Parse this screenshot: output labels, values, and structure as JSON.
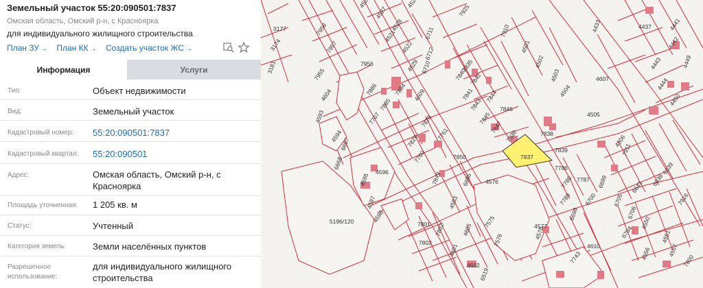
{
  "panel": {
    "title": "Земельный участок 55:20:090501:7837",
    "address_sub": "Омская область, Омский р-н, с Красноярка",
    "purpose": "для индивидуального жилищного строительства",
    "links": [
      {
        "label": "План ЗУ",
        "arrow": "→"
      },
      {
        "label": "План КК",
        "arrow": "→"
      },
      {
        "label": "Создать участок ЖС",
        "arrow": "→"
      }
    ],
    "tools": [
      "map-search-icon",
      "star-icon"
    ],
    "tabs": [
      {
        "label": "Информация",
        "active": true
      },
      {
        "label": "Услуги",
        "active": false
      }
    ],
    "fields": [
      {
        "label": "Тип:",
        "value": "Объект недвижимости",
        "link": false
      },
      {
        "label": "Вид:",
        "value": "Земельный участок",
        "link": false
      },
      {
        "label": "Кадастровый номер:",
        "value": "55:20:090501:7837",
        "link": true
      },
      {
        "label": "Кадастровый квартал:",
        "value": "55:20:090501",
        "link": true
      },
      {
        "label": "Адрес:",
        "value": "Омская область, Омский р-н, с Красноярка",
        "link": false
      },
      {
        "label": "Площадь уточненная:",
        "value": "1 205 кв. м",
        "link": false
      },
      {
        "label": "Статус:",
        "value": "Учтенный",
        "link": false
      },
      {
        "label": "Категория земель:",
        "value": "Земли населённых пунктов",
        "link": false
      },
      {
        "label": "Разрешенное использование:",
        "value": "для индивидуального жилищного строительства",
        "link": false
      }
    ]
  },
  "map": {
    "colors": {
      "boundary": "#d0303d",
      "building": "#e07a84",
      "highlight": "#fff170",
      "background": "#f3f1ee"
    },
    "highlight_label": "7837",
    "parcels": [
      "4526",
      "4527",
      "4528",
      "4524",
      "7925",
      "4521",
      "4522",
      "6711",
      "6712",
      "3177",
      "7958",
      "7957",
      "4529",
      "6710",
      "7956",
      "7955",
      "7886",
      "7884",
      "4604",
      "4609",
      "4593",
      "7885",
      "7767",
      "7840",
      "7842",
      "7835",
      "7841",
      "7843",
      "7844",
      "7845",
      "7847",
      "7846",
      "7836",
      "7838",
      "7839",
      "7828",
      "7829",
      "7761",
      "7850",
      "7760",
      "7849",
      "4594",
      "6667",
      "6668",
      "4596",
      "4595",
      "4597",
      "4598",
      "6686",
      "4583",
      "4576",
      "7786",
      "7788",
      "7787",
      "7789",
      "6699",
      "6700",
      "6698",
      "4577",
      "4578",
      "7801",
      "7802",
      "7803",
      "4601",
      "4605",
      "7575",
      "7576",
      "4602",
      "6519",
      "4610",
      "7743",
      "7910",
      "4501",
      "4502",
      "4503",
      "4504",
      "4505",
      "4506",
      "4607",
      "7911",
      "4433",
      "4437",
      "4441",
      "4442",
      "4443",
      "4444",
      "4449",
      "4450",
      "6639",
      "6638",
      "6641",
      "7916",
      "6705",
      "6706",
      "6704",
      "4550",
      "4551",
      "4556",
      "4557",
      "5196/120",
      "3174",
      "3181",
      "7800"
    ]
  }
}
